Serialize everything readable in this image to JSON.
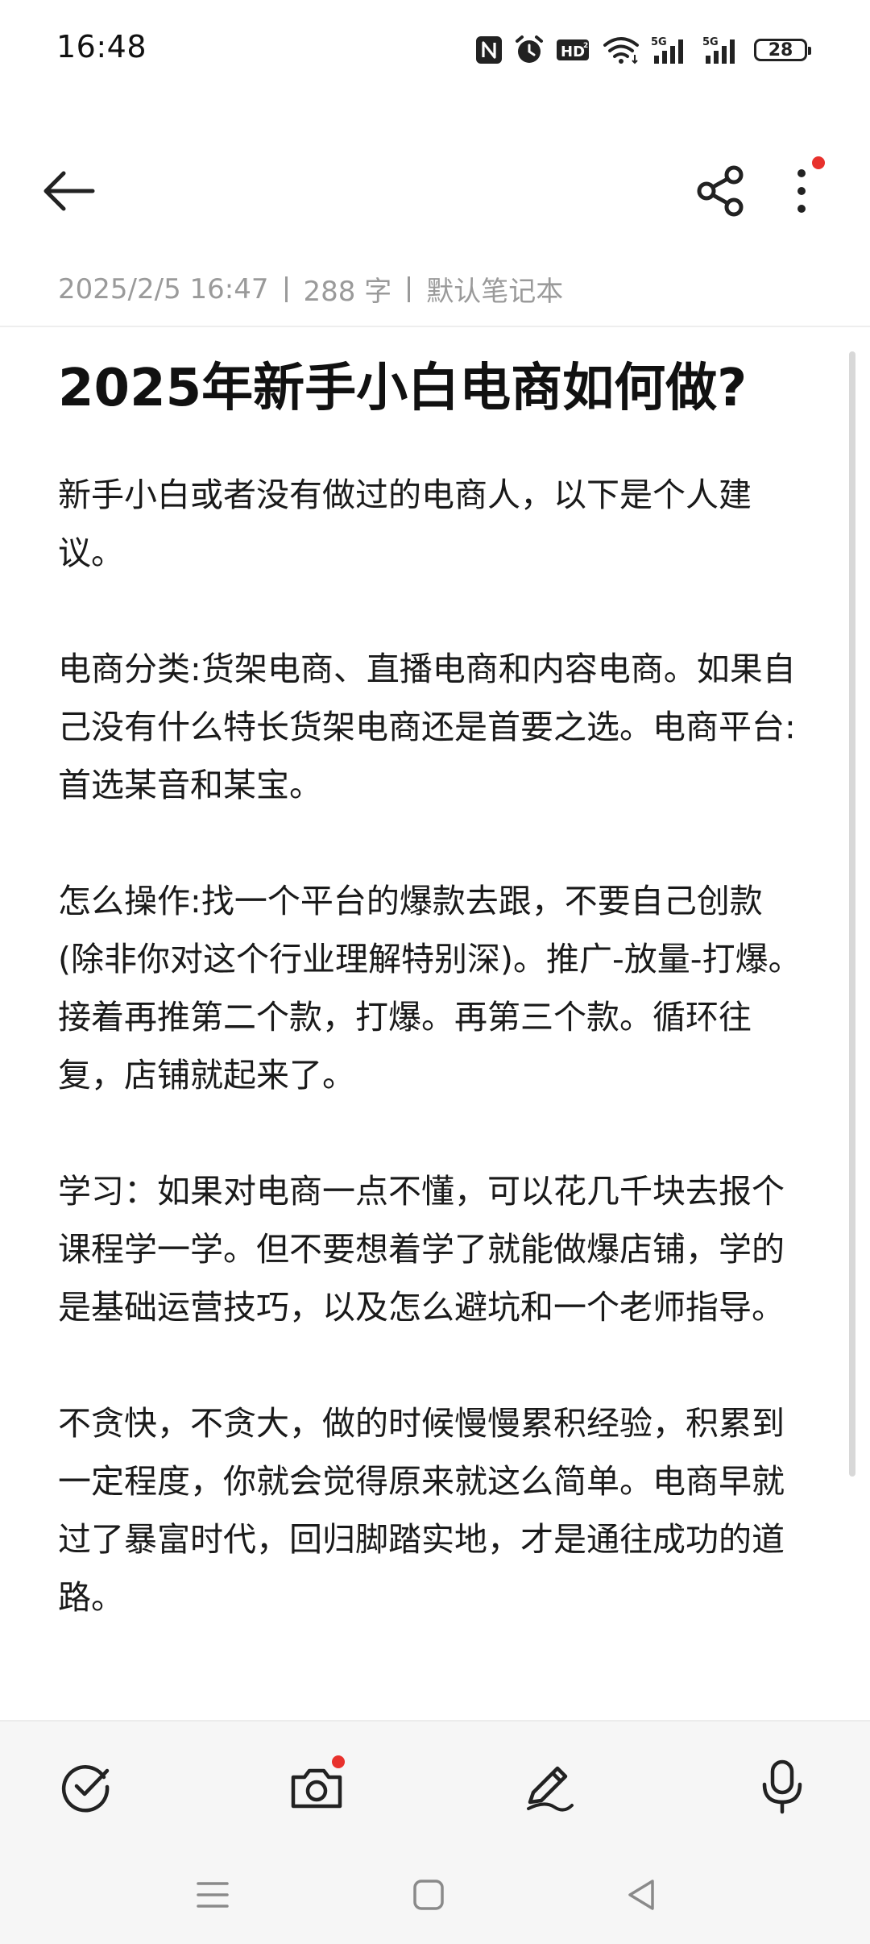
{
  "status_bar": {
    "time": "16:48",
    "battery": "28",
    "icons": [
      "nfc-icon",
      "alarm-icon",
      "hd-icon",
      "wifi-icon",
      "signal-5g-icon",
      "signal-5g-icon"
    ]
  },
  "toolbar": {
    "back_icon": "arrow-left-icon",
    "share_icon": "share-icon",
    "more_icon": "more-vertical-icon",
    "notification_dot_color": "#e8312c"
  },
  "meta": {
    "date": "2025/2/5 16:47",
    "word_count": "288 字",
    "notebook": "默认笔记本"
  },
  "note": {
    "title": "2025年新手小白电商如何做?",
    "paragraphs": [
      "新手小白或者没有做过的电商人，以下是个人建议。",
      "电商分类:货架电商、直播电商和内容电商。如果自己没有什么特长货架电商还是首要之选。电商平台:首选某音和某宝。",
      "怎么操作:找一个平台的爆款去跟，不要自己创款(除非你对这个行业理解特别深)。推广-放量-打爆。接着再推第二个款，打爆。再第三个款。循环往复，店铺就起来了。",
      "学习：如果对电商一点不懂，可以花几千块去报个课程学一学。但不要想着学了就能做爆店铺，学的是基础运营技巧，以及怎么避坑和一个老师指导。",
      "不贪快，不贪大，做的时候慢慢累积经验，积累到一定程度，你就会觉得原来就这么简单。电商早就过了暴富时代，回归脚踏实地，才是通往成功的道路。"
    ]
  },
  "bottom_toolbar": {
    "items": [
      "checklist-icon",
      "camera-icon",
      "pen-icon",
      "microphone-icon"
    ]
  },
  "nav_bar": {
    "items": [
      "menu-icon",
      "home-square-icon",
      "back-triangle-icon"
    ]
  }
}
